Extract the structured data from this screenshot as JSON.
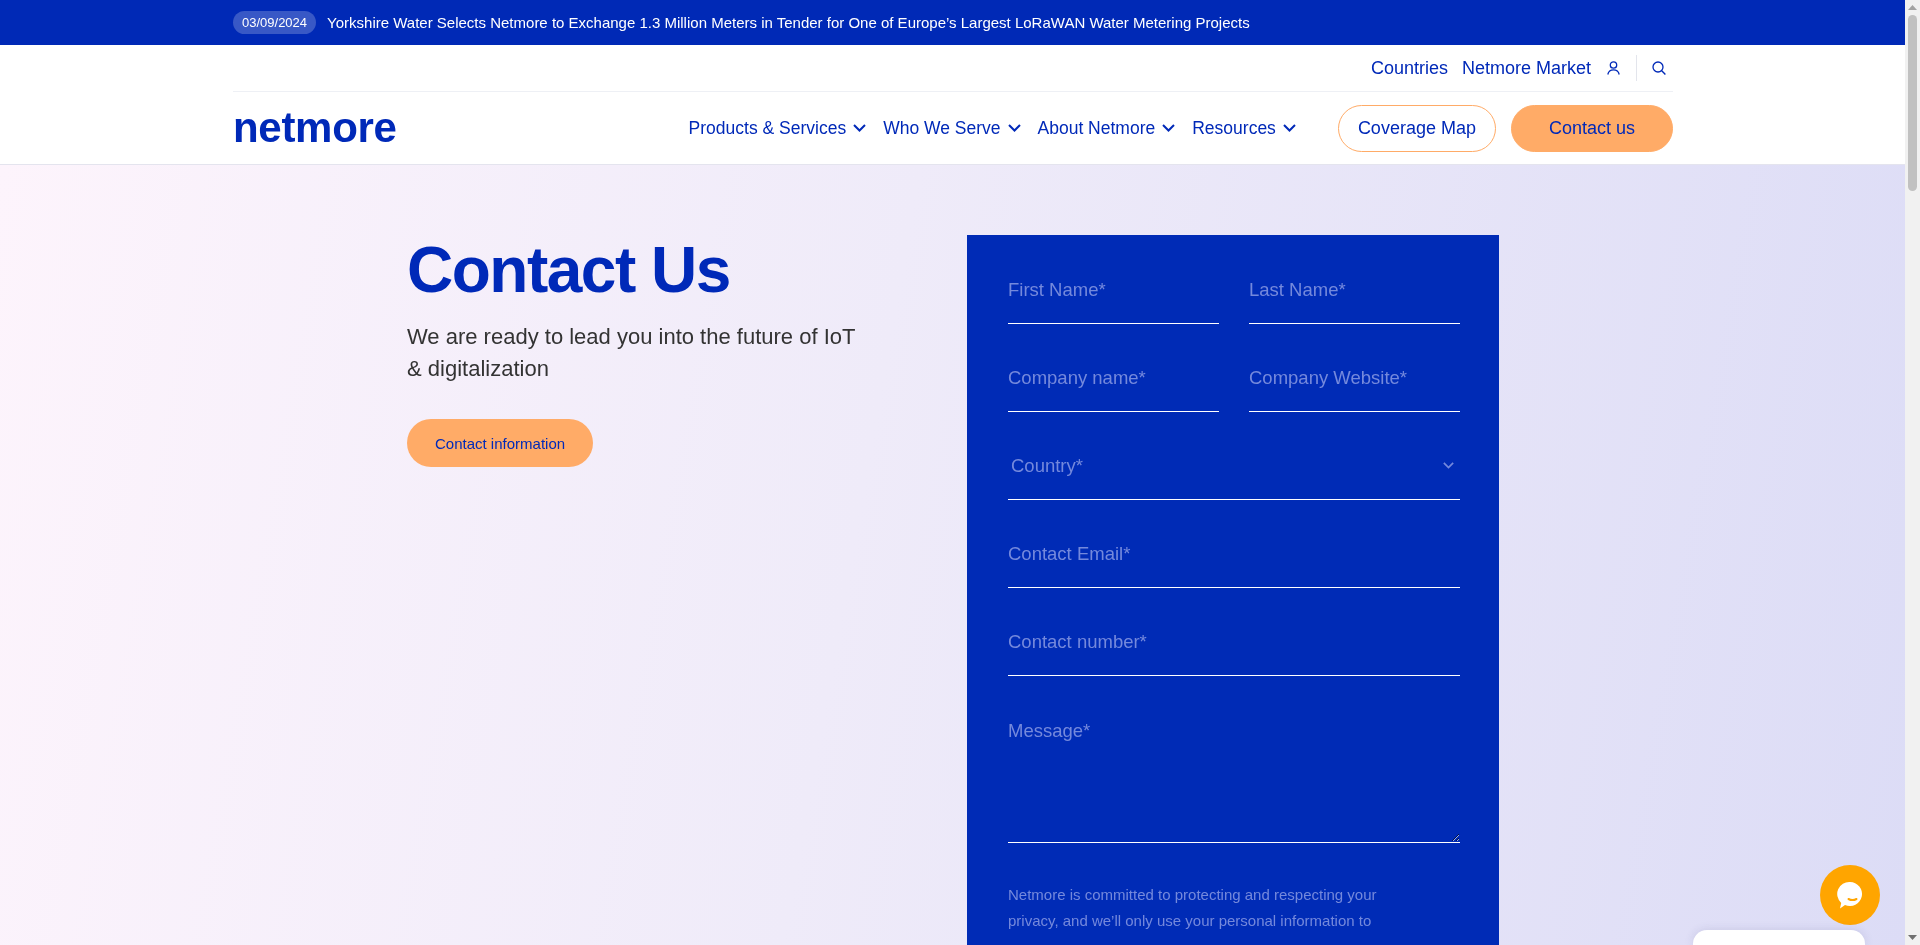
{
  "announcement_bar": {
    "date": "03/09/2024",
    "headline": "Yorkshire Water Selects Netmore to Exchange 1.3 Million Meters in Tender for One of Europe’s Largest LoRaWAN Water Metering Projects"
  },
  "header": {
    "utility_links": [
      "Countries",
      "Netmore Market"
    ],
    "logo": "netmore",
    "nav": [
      {
        "label": "Products & Services",
        "dropdown": true
      },
      {
        "label": "Who We Serve",
        "dropdown": true
      },
      {
        "label": "About Netmore",
        "dropdown": true
      },
      {
        "label": "Resources",
        "dropdown": true
      }
    ],
    "buttons": [
      {
        "label": "Coverage Map",
        "kind": "outline"
      },
      {
        "label": "Contact us",
        "kind": "filled"
      }
    ]
  },
  "hero": {
    "title": "Contact Us",
    "subtitle": "We are ready to lead you into the future of IoT & digitalization",
    "button": "Contact information"
  },
  "form": {
    "rows": [
      [
        {
          "kind": "text",
          "placeholder": "First Name*"
        },
        {
          "kind": "text",
          "placeholder": "Last Name*"
        }
      ],
      [
        {
          "kind": "text",
          "placeholder": "Company name*"
        },
        {
          "kind": "text",
          "placeholder": "Company Website*"
        }
      ],
      [
        {
          "kind": "select",
          "placeholder": "Country*"
        }
      ],
      [
        {
          "kind": "text",
          "placeholder": "Contact Email*"
        }
      ],
      [
        {
          "kind": "text",
          "placeholder": "Contact number*"
        }
      ],
      [
        {
          "kind": "textarea",
          "placeholder": "Message*"
        }
      ]
    ],
    "privacy_notice": "Netmore is committed to protecting and respecting your privacy, and we’ll only use your personal information to"
  }
}
